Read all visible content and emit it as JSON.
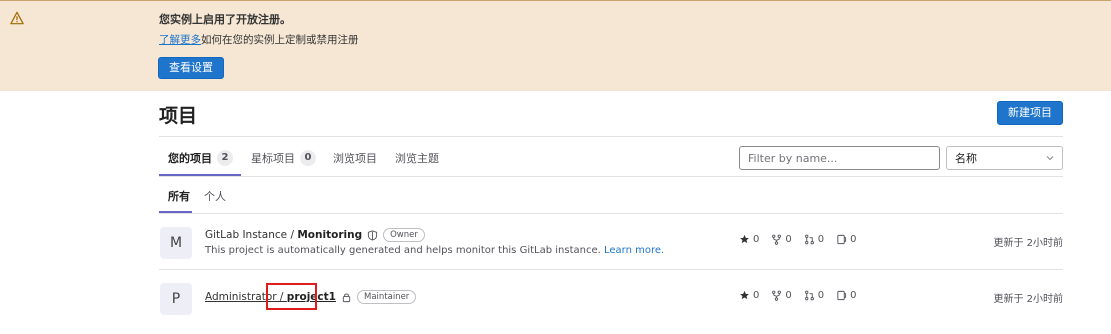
{
  "alert": {
    "title": "您实例上启用了开放注册。",
    "link_text": "了解更多",
    "body_text": "如何在您的实例上定制或禁用注册",
    "button": "查看设置",
    "icon": "warning-icon"
  },
  "page": {
    "title": "项目",
    "new_button": "新建项目"
  },
  "tabs": [
    {
      "label": "您的项目",
      "count": "2"
    },
    {
      "label": "星标项目",
      "count": "0"
    },
    {
      "label": "浏览项目"
    },
    {
      "label": "浏览主题"
    }
  ],
  "filter": {
    "placeholder": "Filter by name..."
  },
  "sort": {
    "selected": "名称"
  },
  "subtabs": [
    "所有",
    "个人"
  ],
  "projects": [
    {
      "avatar": "M",
      "namespace": "GitLab Instance / ",
      "name": "Monitoring",
      "role": "Owner",
      "description": "This project is automatically generated and helps monitor this GitLab instance.",
      "learn_more": "Learn more.",
      "stars": "0",
      "forks": "0",
      "merge_requests": "0",
      "issues": "0",
      "updated": "更新于 2小时前"
    },
    {
      "avatar": "P",
      "namespace": "Administrator / ",
      "name": "project1",
      "role": "Maintainer",
      "stars": "0",
      "forks": "0",
      "merge_requests": "0",
      "issues": "0",
      "updated": "更新于 2小时前"
    }
  ],
  "colors": {
    "alert_bg": "#f5e7d3",
    "primary": "#1f75cb",
    "tab_underline": "#6666c4",
    "highlight": "#e01b1b"
  }
}
